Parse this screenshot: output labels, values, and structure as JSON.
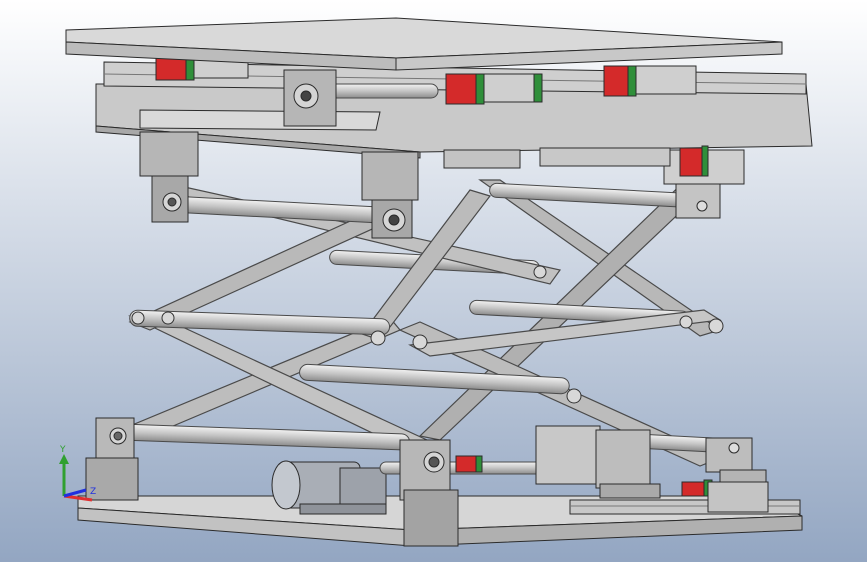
{
  "viewport": {
    "background_top": "#ffffff",
    "background_bottom": "#93a6c2"
  },
  "palette": {
    "plate_top": "#d6d6d6",
    "plate_side": "#b4b4b4",
    "plate_dark": "#8e8e8e",
    "bar": "#bcbcbc",
    "bar_edge": "#5f5f5f",
    "rod": "#c9c9c9",
    "carriage_red": "#d42a2a",
    "carriage_green": "#2f8f3a",
    "motor": "#a9aeb6",
    "edge": "#2b2b2b"
  },
  "triad": {
    "y_label": "Y",
    "z_label": "Z",
    "x_color": "#e03030",
    "y_color": "#30a030",
    "z_color": "#2030e0"
  }
}
